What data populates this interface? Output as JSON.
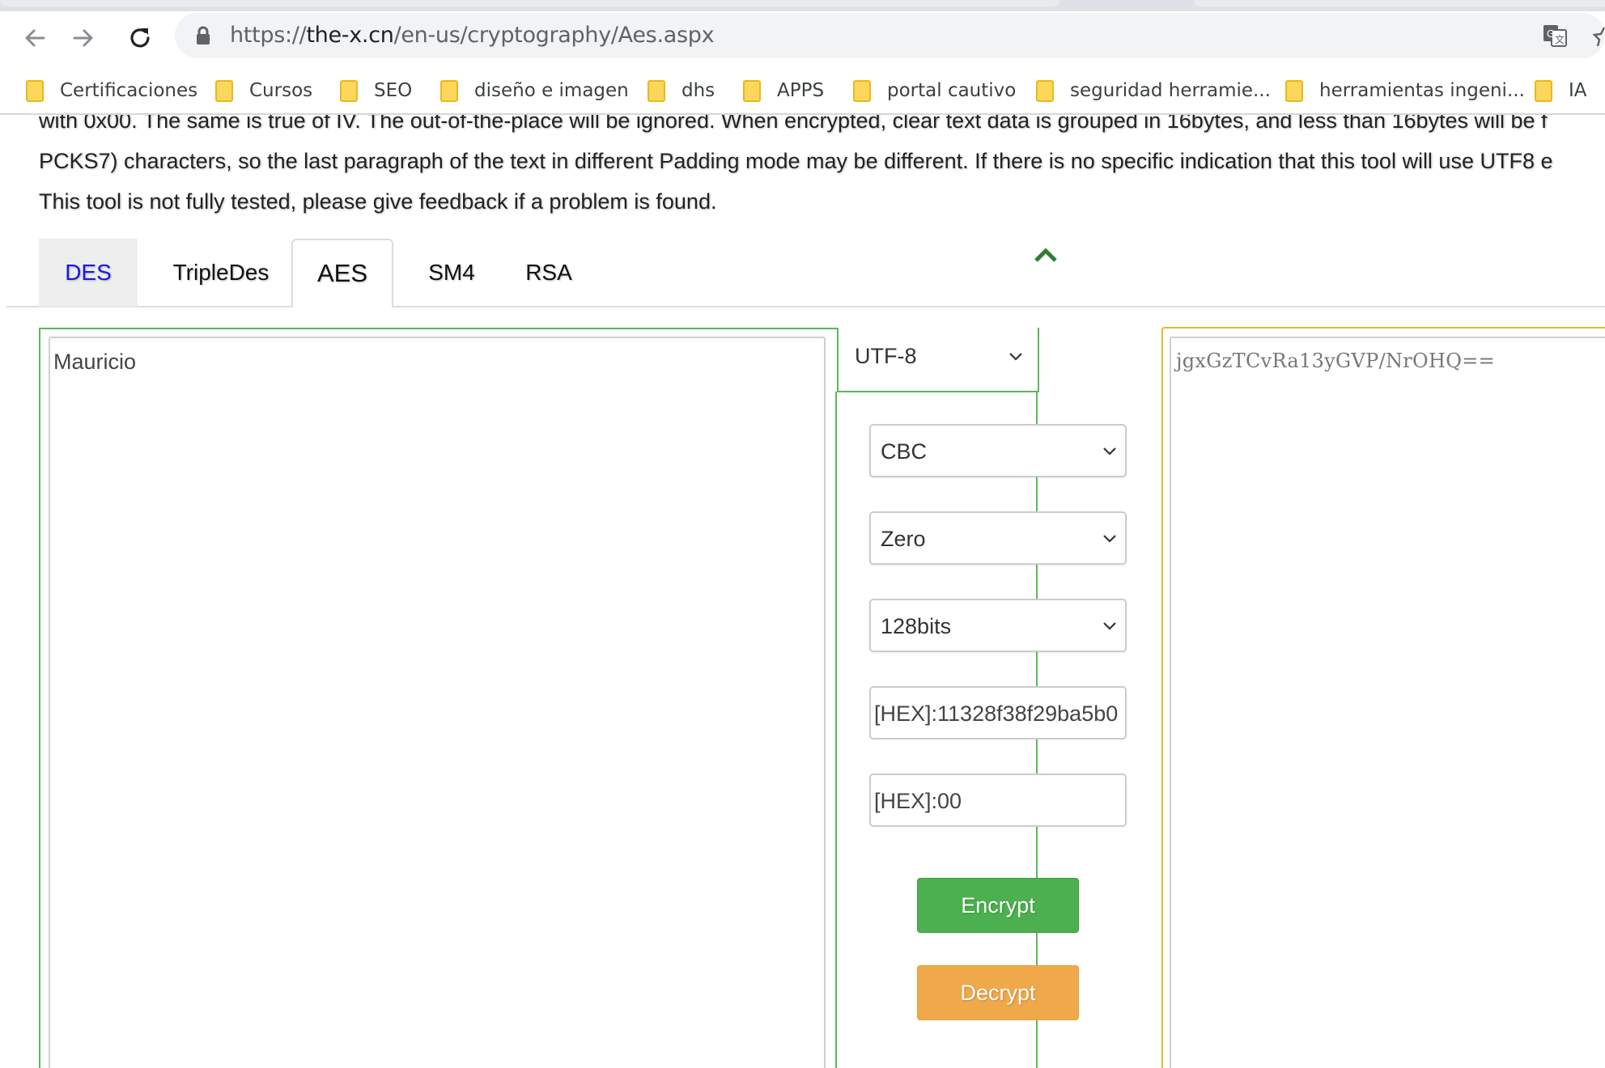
{
  "browser": {
    "url_scheme": "https://",
    "url_host": "the-x.cn",
    "url_path": "/en-us/cryptography/Aes.aspx",
    "bookmarks": [
      {
        "label": "Certificaciones"
      },
      {
        "label": "Cursos"
      },
      {
        "label": "SEO"
      },
      {
        "label": "diseño e imagen"
      },
      {
        "label": "dhs"
      },
      {
        "label": "APPS"
      },
      {
        "label": "portal cautivo"
      },
      {
        "label": "seguridad herramie..."
      },
      {
        "label": "herramientas ingeni..."
      },
      {
        "label": "IA"
      }
    ]
  },
  "description": {
    "lines": [
      "with 0x00. The same is true of IV. The out-of-the-place will be ignored. When encrypted, clear text data is grouped in 16bytes, and less than 16bytes will be f",
      "PCKS7) characters, so the last paragraph of the text in different Padding mode may be different. If there is no specific indication that this tool will use UTF8 e",
      "This tool is not fully tested, please give feedback if a problem is found."
    ]
  },
  "tabs": [
    {
      "label": "DES"
    },
    {
      "label": "TripleDes"
    },
    {
      "label": "AES"
    },
    {
      "label": "SM4"
    },
    {
      "label": "RSA"
    }
  ],
  "form": {
    "plaintext": "Mauricio",
    "charset": "UTF-8",
    "mode": "CBC",
    "padding": "Zero",
    "key_size": "128bits",
    "key": "[HEX]:11328f38f29ba5b0",
    "iv": "[HEX]:00",
    "encrypt_label": "Encrypt",
    "decrypt_label": "Decrypt",
    "ciphertext": "jgxGzTCvRa13yGVP/NrOHQ=="
  },
  "colors": {
    "input_border": "#5cb85c",
    "output_border": "#e5b828",
    "encrypt": "#4cb050",
    "decrypt": "#efa94b",
    "active_tab_link": "#1a1ae0"
  }
}
